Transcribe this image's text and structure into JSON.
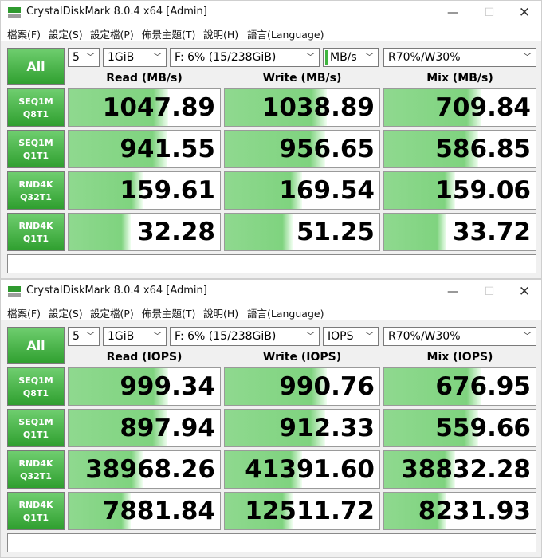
{
  "windows": [
    {
      "title": "CrystalDiskMark 8.0.4 x64 [Admin]",
      "menu": [
        "檔案(F)",
        "設定(S)",
        "設定檔(P)",
        "佈景主題(T)",
        "說明(H)",
        "語言(Language)"
      ],
      "all_label": "All",
      "controls": {
        "count": "5",
        "size": "1GiB",
        "drive": "F: 6% (15/238GiB)",
        "unit": "MB/s",
        "mix_ratio": "R70%/W30%"
      },
      "headers": {
        "read": "Read (MB/s)",
        "write": "Write (MB/s)",
        "mix": "Mix (MB/s)"
      },
      "rows": [
        {
          "l1": "SEQ1M",
          "l2": "Q8T1",
          "read": "1047.89",
          "write": "1038.89",
          "mix": "709.84",
          "fill": [
            0.66,
            0.66,
            0.64
          ]
        },
        {
          "l1": "SEQ1M",
          "l2": "Q1T1",
          "read": "941.55",
          "write": "956.65",
          "mix": "586.85",
          "fill": [
            0.65,
            0.65,
            0.62
          ]
        },
        {
          "l1": "RND4K",
          "l2": "Q32T1",
          "read": "159.61",
          "write": "169.54",
          "mix": "159.06",
          "fill": [
            0.49,
            0.5,
            0.47
          ]
        },
        {
          "l1": "RND4K",
          "l2": "Q1T1",
          "read": "32.28",
          "write": "51.25",
          "mix": "33.72",
          "fill": [
            0.41,
            0.44,
            0.41
          ]
        }
      ],
      "status": ""
    },
    {
      "title": "CrystalDiskMark 8.0.4 x64 [Admin]",
      "menu": [
        "檔案(F)",
        "設定(S)",
        "設定檔(P)",
        "佈景主題(T)",
        "說明(H)",
        "語言(Language)"
      ],
      "all_label": "All",
      "controls": {
        "count": "5",
        "size": "1GiB",
        "drive": "F: 6% (15/238GiB)",
        "unit": "IOPS",
        "mix_ratio": "R70%/W30%"
      },
      "headers": {
        "read": "Read (IOPS)",
        "write": "Write (IOPS)",
        "mix": "Mix (IOPS)"
      },
      "rows": [
        {
          "l1": "SEQ1M",
          "l2": "Q8T1",
          "read": "999.34",
          "write": "990.76",
          "mix": "676.95",
          "fill": [
            0.66,
            0.66,
            0.64
          ]
        },
        {
          "l1": "SEQ1M",
          "l2": "Q1T1",
          "read": "897.94",
          "write": "912.33",
          "mix": "559.66",
          "fill": [
            0.65,
            0.65,
            0.62
          ]
        },
        {
          "l1": "RND4K",
          "l2": "Q32T1",
          "read": "38968.26",
          "write": "41391.60",
          "mix": "38832.28",
          "fill": [
            0.49,
            0.5,
            0.47
          ]
        },
        {
          "l1": "RND4K",
          "l2": "Q1T1",
          "read": "7881.84",
          "write": "12511.72",
          "mix": "8231.93",
          "fill": [
            0.41,
            0.44,
            0.41
          ]
        }
      ],
      "status": ""
    }
  ],
  "colors": {
    "button_top": "#6fce6f",
    "button_bottom": "#2f9f2f",
    "bar": "#7fd37f",
    "accent": "#3fb53f"
  }
}
